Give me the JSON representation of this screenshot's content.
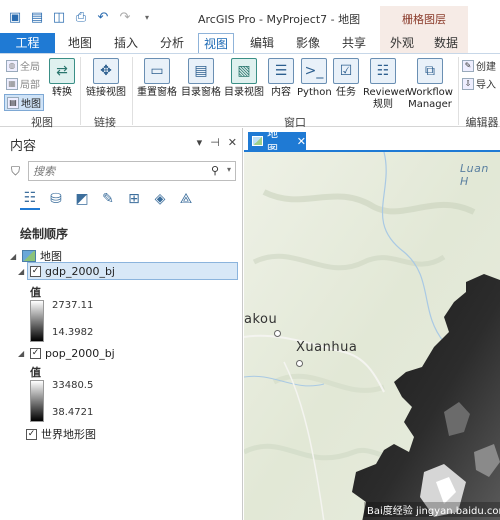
{
  "app": {
    "title": "ArcGIS Pro - MyProject7 - 地图",
    "context_header": "栅格图层"
  },
  "qat": [
    {
      "icon": "new-project-icon"
    },
    {
      "icon": "open-folder-icon"
    },
    {
      "icon": "save-icon"
    },
    {
      "icon": "print-icon"
    },
    {
      "icon": "undo-icon"
    },
    {
      "icon": "redo-icon"
    },
    {
      "icon": "customize-dropdown-icon"
    }
  ],
  "tabs": [
    "工程",
    "地图",
    "插入",
    "分析",
    "视图",
    "编辑",
    "影像",
    "共享",
    "外观",
    "数据"
  ],
  "active_tab": "视图",
  "ribbon": {
    "view_group": {
      "label": "视图",
      "global_label": "全局",
      "local_label": "局部",
      "map_label": "地图",
      "convert_label": "转换"
    },
    "link_group": {
      "label": "链接",
      "link_views_label": "链接视图"
    },
    "window_group": {
      "label": "窗口",
      "buttons": [
        "重置窗格",
        "目录窗格",
        "目录视图",
        "内容",
        "Python",
        "任务",
        "Reviewer 规则",
        "Workflow Manager"
      ]
    },
    "edit_group": {
      "label": "编辑器",
      "create_label": "创建",
      "import_label": "导入"
    }
  },
  "contents_pane": {
    "title": "内容",
    "controls": [
      "▾",
      "⊣",
      "✕"
    ],
    "search_placeholder": "搜索",
    "draw_order_label": "绘制顺序",
    "map_name": "地图",
    "layers": [
      {
        "name": "gdp_2000_bj",
        "checked": "✓",
        "legend_title": "值",
        "high": "2737.11",
        "low": "14.3982"
      },
      {
        "name": "pop_2000_bj",
        "checked": "✓",
        "legend_title": "值",
        "high": "33480.5",
        "low": "38.4721"
      }
    ],
    "basemap": {
      "name": "世界地形图",
      "checked": "✓"
    }
  },
  "map_view": {
    "tab_label": "地图",
    "tab_close": "✕",
    "labels": {
      "luan": "Luan H",
      "zhangjiakou": "akou",
      "xuanhua": "Xuanhua"
    }
  },
  "watermark": "Bai度经验 jingyan.baidu.com"
}
